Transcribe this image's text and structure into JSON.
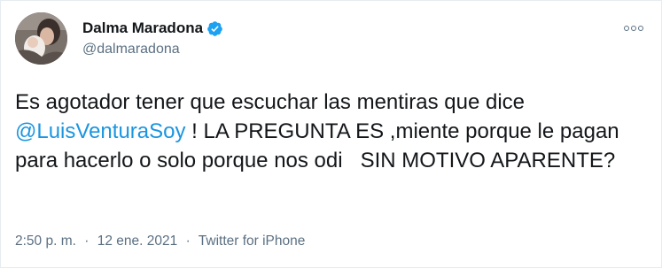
{
  "author": {
    "display_name": "Dalma Maradona",
    "handle": "@dalmaradona",
    "verified": true,
    "avatar_icon": "profile-photo"
  },
  "tweet": {
    "text_before": "Es agotador tener que escuchar las mentiras que dice ",
    "mention": "@LuisVenturaSoy",
    "text_after": " ! LA PREGUNTA ES ,miente porque le pagan para hacerlo o solo porque nos odi   SIN MOTIVO APARENTE?"
  },
  "meta": {
    "time": "2:50 p. m.",
    "separator": "·",
    "date": "12 ene. 2021",
    "source": "Twitter for iPhone"
  },
  "icons": {
    "more": "more-options-icon",
    "verified": "verified-badge-icon"
  },
  "colors": {
    "accent": "#1b95e0",
    "secondary_text": "#5b7083",
    "primary_text": "#14171a"
  }
}
